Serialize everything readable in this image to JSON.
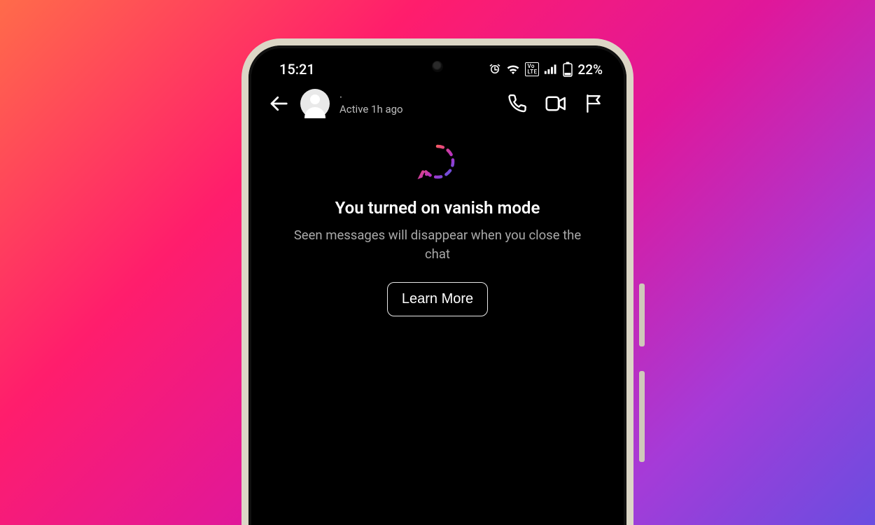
{
  "status_bar": {
    "time": "15:21",
    "battery_text": "22%",
    "icons": {
      "alarm": "alarm-icon",
      "wifi": "wifi-icon",
      "volte": "volte-icon",
      "signal": "signal-icon",
      "battery": "battery-icon"
    }
  },
  "chat_header": {
    "contact_name": "·",
    "active_status": "Active 1h ago"
  },
  "vanish_mode": {
    "title": "You turned on vanish mode",
    "subtitle": "Seen messages will disappear when you close the chat",
    "learn_more_label": "Learn More"
  }
}
